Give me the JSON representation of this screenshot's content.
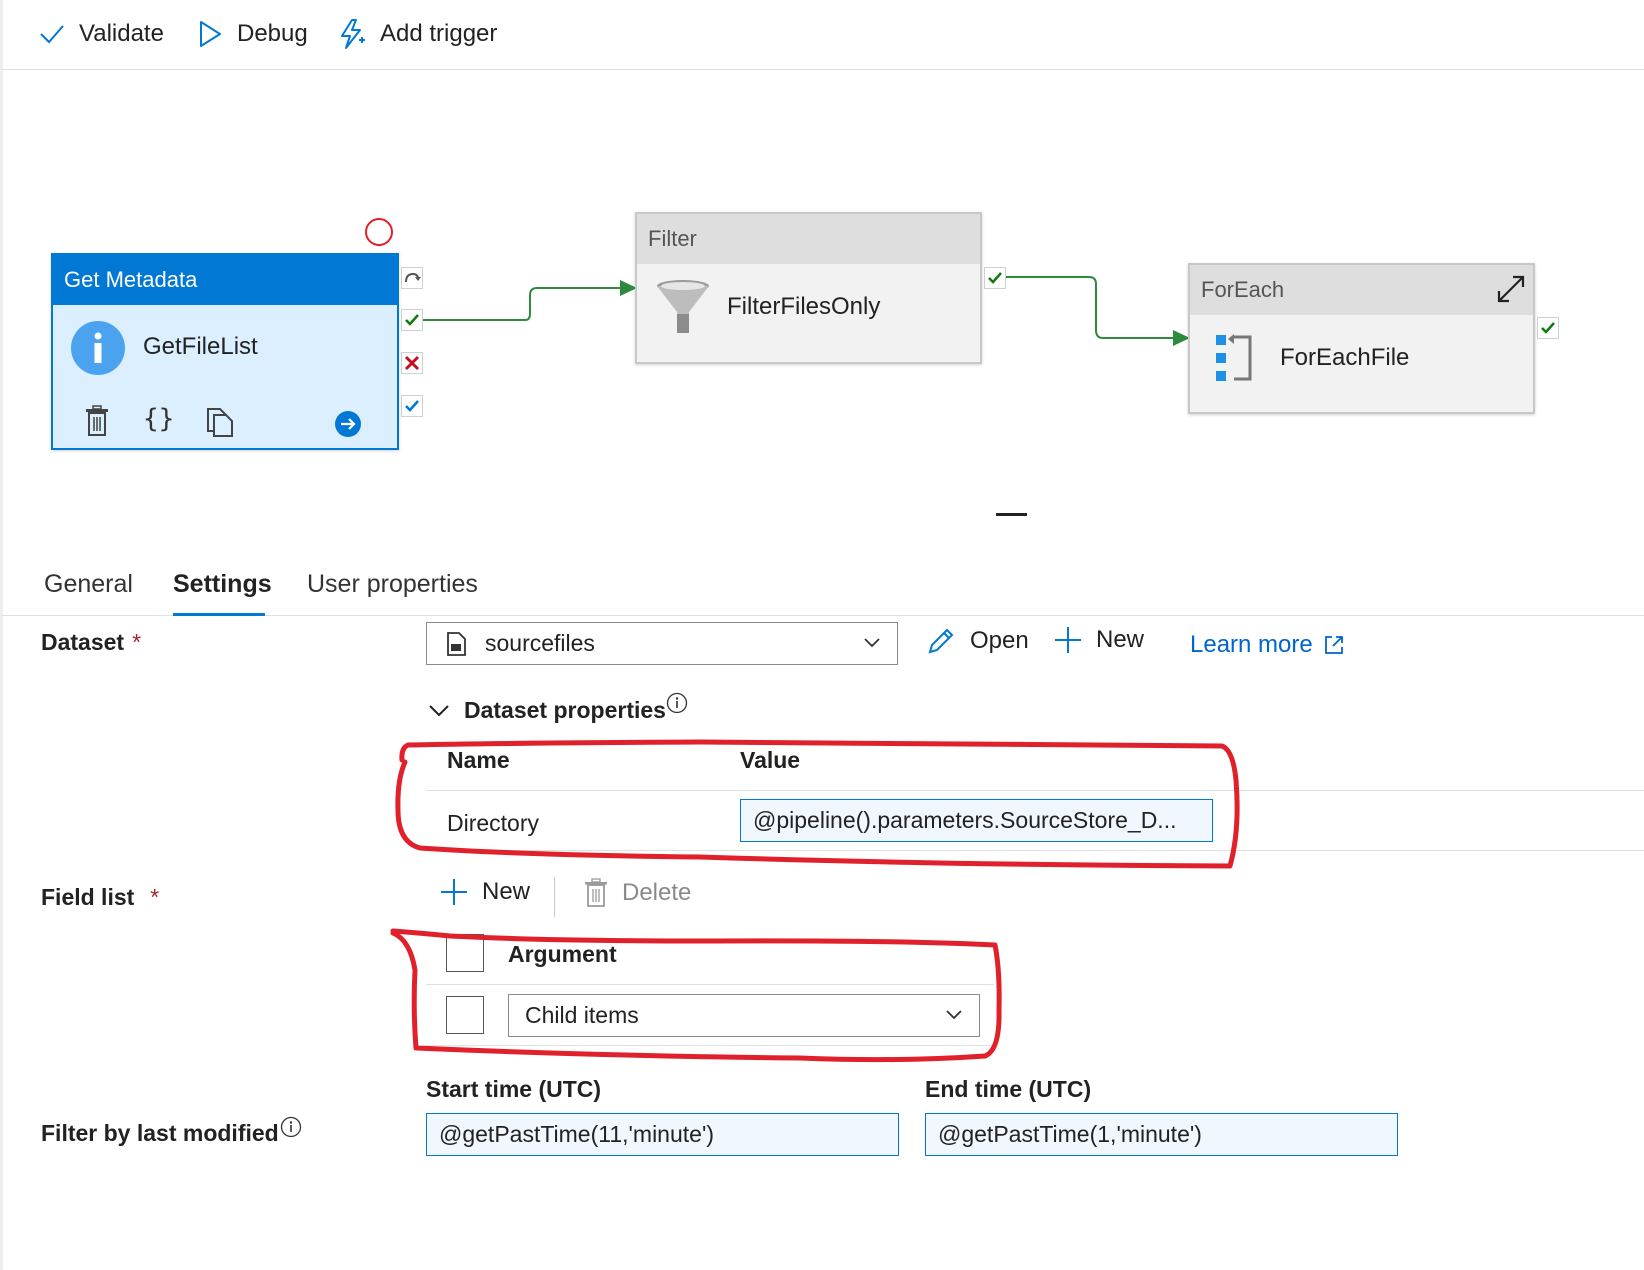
{
  "toolbar": {
    "validate_label": "Validate",
    "debug_label": "Debug",
    "add_trigger_label": "Add trigger"
  },
  "canvas": {
    "activities": [
      {
        "type": "Get Metadata",
        "name": "GetFileList",
        "icon": "info-icon"
      },
      {
        "type": "Filter",
        "name": "FilterFilesOnly",
        "icon": "funnel-icon"
      },
      {
        "type": "ForEach",
        "name": "ForEachFile",
        "icon": "foreach-icon"
      }
    ]
  },
  "tabs": [
    {
      "label": "General"
    },
    {
      "label": "Settings",
      "active": true
    },
    {
      "label": "User properties"
    }
  ],
  "settings": {
    "dataset": {
      "label": "Dataset",
      "required_mark": "*",
      "value": "sourcefiles",
      "open_label": "Open",
      "new_label": "New",
      "learn_more_label": "Learn more"
    },
    "dataset_properties": {
      "title": "Dataset properties",
      "name_header": "Name",
      "value_header": "Value",
      "rows": [
        {
          "name": "Directory",
          "value": "@pipeline().parameters.SourceStore_D..."
        }
      ]
    },
    "field_list": {
      "label": "Field list",
      "required_mark": "*",
      "new_label": "New",
      "delete_label": "Delete",
      "argument_header": "Argument",
      "rows": [
        {
          "value": "Child items"
        }
      ]
    },
    "filter_by_last_modified": {
      "label": "Filter by last modified",
      "start_label": "Start time (UTC)",
      "start_value": "@getPastTime(11,'minute')",
      "end_label": "End time (UTC)",
      "end_value": "@getPastTime(1,'minute')"
    }
  },
  "colors": {
    "accent": "#0078d4",
    "success": "#107c10",
    "failure": "#c50f1f",
    "annotation": "#e0202a"
  }
}
